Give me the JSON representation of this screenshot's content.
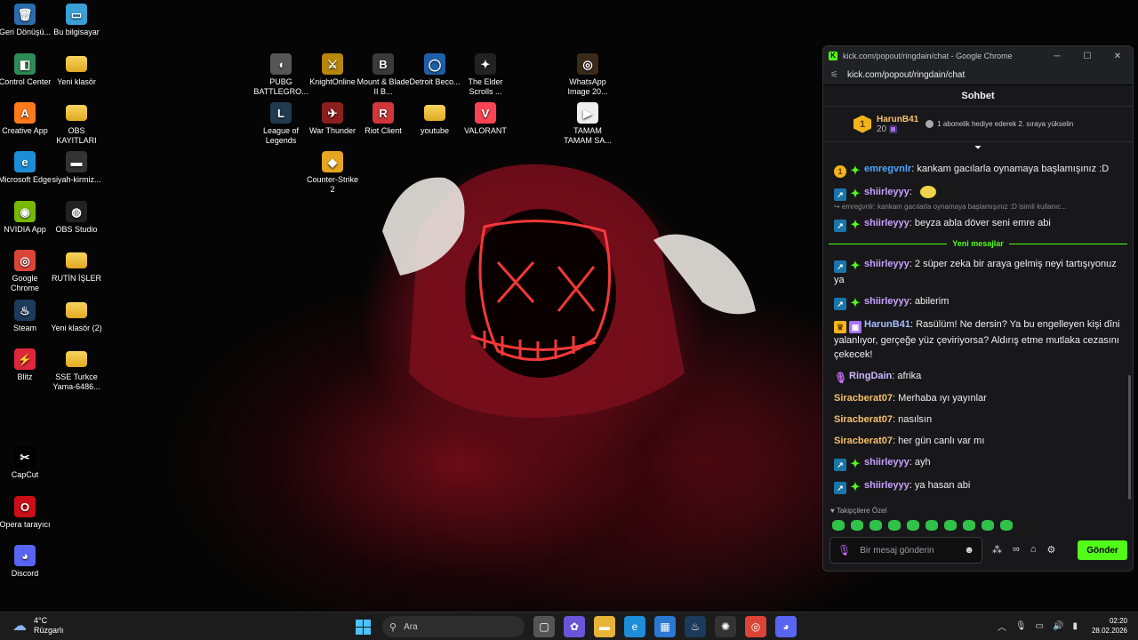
{
  "desktop": {
    "icons_col1": [
      {
        "label": "Geri Dönüşü...",
        "icon": "recycle-bin-icon",
        "glyph": "🗑",
        "color": "#2b6cb0"
      },
      {
        "label": "Control Center",
        "icon": "control-center-icon",
        "glyph": "◧",
        "color": "#2e8b57"
      },
      {
        "label": "Creative App",
        "icon": "creative-app-icon",
        "glyph": "A",
        "color": "#ff7a1a"
      },
      {
        "label": "Microsoft Edge",
        "icon": "edge-icon",
        "glyph": "e",
        "color": "#1c8dd9"
      },
      {
        "label": "NVIDIA App",
        "icon": "nvidia-icon",
        "glyph": "◉",
        "color": "#76b900"
      },
      {
        "label": "Google Chrome",
        "icon": "chrome-icon",
        "glyph": "◎",
        "color": "#db4437"
      },
      {
        "label": "Steam",
        "icon": "steam-icon",
        "glyph": "♨",
        "color": "#1b3a5c"
      },
      {
        "label": "Blitz",
        "icon": "blitz-icon",
        "glyph": "⚡",
        "color": "#e0263b"
      },
      {
        "label": "CapCut",
        "icon": "capcut-icon",
        "glyph": "✂",
        "color": "#000000"
      },
      {
        "label": "Opera tarayıcı",
        "icon": "opera-icon",
        "glyph": "O",
        "color": "#cc0f16"
      },
      {
        "label": "Discord",
        "icon": "discord-icon",
        "glyph": "◕",
        "color": "#5865f2"
      }
    ],
    "icons_col2": [
      {
        "label": "Bu bilgisayar",
        "icon": "this-pc-icon",
        "glyph": "▭",
        "color": "#3aa0d8"
      },
      {
        "label": "Yeni klasör",
        "icon": "folder-icon",
        "glyph": "",
        "color": "folder"
      },
      {
        "label": "OBS KAYITLARI",
        "icon": "folder-icon",
        "glyph": "",
        "color": "folder"
      },
      {
        "label": "siyah-kirmiz...",
        "icon": "image-file-icon",
        "glyph": "▬",
        "color": "#333333"
      },
      {
        "label": "OBS Studio",
        "icon": "obs-icon",
        "glyph": "◍",
        "color": "#222222"
      },
      {
        "label": "RUTİN İŞLER",
        "icon": "folder-icon",
        "glyph": "",
        "color": "folder"
      },
      {
        "label": "Yeni klasör (2)",
        "icon": "folder-icon",
        "glyph": "",
        "color": "folder"
      },
      {
        "label": "SSE Turkce Yama-6486...",
        "icon": "folder-icon",
        "glyph": "",
        "color": "folder"
      }
    ],
    "icons_games": [
      {
        "label": "PUBG BATTLEGRO...",
        "icon": "pubg-icon",
        "glyph": "◖",
        "color": "#555555"
      },
      {
        "label": "KnightOnline",
        "icon": "knightonline-icon",
        "glyph": "⚔",
        "color": "#b8860b"
      },
      {
        "label": "Mount & Blade II B...",
        "icon": "bannerlord-icon",
        "glyph": "B",
        "color": "#3a3a3a"
      },
      {
        "label": "Detroit Beco...",
        "icon": "detroit-icon",
        "glyph": "◯",
        "color": "#1e5fa8"
      },
      {
        "label": "The Elder Scrolls ...",
        "icon": "elder-scrolls-icon",
        "glyph": "✦",
        "color": "#222222"
      },
      {
        "label": "WhatsApp Image 20...",
        "icon": "whatsapp-image-icon",
        "glyph": "◎",
        "color": "#3a2a1a"
      },
      {
        "label": "League of Legends",
        "icon": "league-icon",
        "glyph": "L",
        "color": "#1f3b4d"
      },
      {
        "label": "War Thunder",
        "icon": "war-thunder-icon",
        "glyph": "✈",
        "color": "#8b1e1e"
      },
      {
        "label": "Riot Client",
        "icon": "riot-icon",
        "glyph": "R",
        "color": "#d13639"
      },
      {
        "label": "youtube",
        "icon": "folder-icon",
        "glyph": "",
        "color": "folder"
      },
      {
        "label": "VALORANT",
        "icon": "valorant-icon",
        "glyph": "V",
        "color": "#fa4454"
      },
      {
        "label": "TAMAM TAMAM SA...",
        "icon": "video-file-icon",
        "glyph": "▶",
        "color": "#eeeeee"
      },
      {
        "label": "Counter-Strike 2",
        "icon": "cs2-icon",
        "glyph": "◆",
        "color": "#e6a421"
      }
    ]
  },
  "popup": {
    "title": "kick.com/popout/ringdain/chat - Google Chrome",
    "url": "kick.com/popout/ringdain/chat",
    "chat_title": "Sohbet",
    "pinned": {
      "user": "HarunB41",
      "count": "20",
      "rank": "1",
      "text": "1 abonelik hediye ederek 2. sıraya yükselin"
    },
    "messages": [
      {
        "badges": [
          "b-one:1",
          "b-star:✦"
        ],
        "user": "emregvnlr",
        "ucls": "u-blue",
        "text": "kankam gacılarla oynamaya başlamışınız :D"
      },
      {
        "badges": [
          "b-vip:↗",
          "b-star:✦"
        ],
        "user": "shiirleyyy",
        "ucls": "u-purple",
        "text": "",
        "emote": true
      },
      {
        "reply": "↪ emregvnlr: kankam gacılarla oynamaya başlamışınız :D isimli kullanıc..."
      },
      {
        "badges": [
          "b-vip:↗",
          "b-star:✦"
        ],
        "user": "shiirleyyy",
        "ucls": "u-purple",
        "text": "beyza abla döver seni emre abi"
      },
      {
        "separator": "Yeni mesajlar"
      },
      {
        "badges": [
          "b-vip:↗",
          "b-star:✦"
        ],
        "user": "shiirleyyy",
        "ucls": "u-purple",
        "text": "2 süper zeka bir araya gelmiş neyi tartışıyonuz ya"
      },
      {
        "badges": [
          "b-vip:↗",
          "b-star:✦"
        ],
        "user": "shiirleyyy",
        "ucls": "u-purple",
        "text": "abilerim"
      },
      {
        "badges": [
          "b-crown:♛",
          "b-gift:▣"
        ],
        "user": "HarunB41",
        "ucls": "u-harun",
        "text": "Rasülüm! Ne dersin? Ya bu engelleyen kişi dîni yalanlıyor, gerçeğe yüz çeviriyorsa? Aldırış etme mutlaka cezasını çekecek!"
      },
      {
        "badges": [
          "b-mic:🎙"
        ],
        "user": "RingDain",
        "ucls": "u-lav",
        "text": "afrika"
      },
      {
        "badges": [],
        "user": "Siracberat07",
        "ucls": "u-gold",
        "text": "Merhaba ıyı yayınlar"
      },
      {
        "badges": [],
        "user": "Siracberat07",
        "ucls": "u-gold",
        "text": "nasılsın"
      },
      {
        "badges": [],
        "user": "Siracberat07",
        "ucls": "u-gold",
        "text": "her gün canlı var mı"
      },
      {
        "badges": [
          "b-vip:↗",
          "b-star:✦"
        ],
        "user": "shiirleyyy",
        "ucls": "u-purple",
        "text": "ayh"
      },
      {
        "badges": [
          "b-vip:↗",
          "b-star:✦"
        ],
        "user": "shiirleyyy",
        "ucls": "u-purple",
        "text": "ya hasan abi"
      }
    ],
    "followers_label": "♥ Takipçilere Özel",
    "composer_placeholder": "Bir mesaj gönderin",
    "send_label": "Gönder"
  },
  "taskbar": {
    "temperature": "4°C",
    "weather": "Rüzgarlı",
    "search_label": "Ara",
    "time": "02:20",
    "date": "28.02.2026",
    "apps": [
      "file-explorer",
      "copilot",
      "files",
      "edge",
      "store",
      "steam",
      "chatgpt",
      "chrome",
      "discord"
    ]
  }
}
